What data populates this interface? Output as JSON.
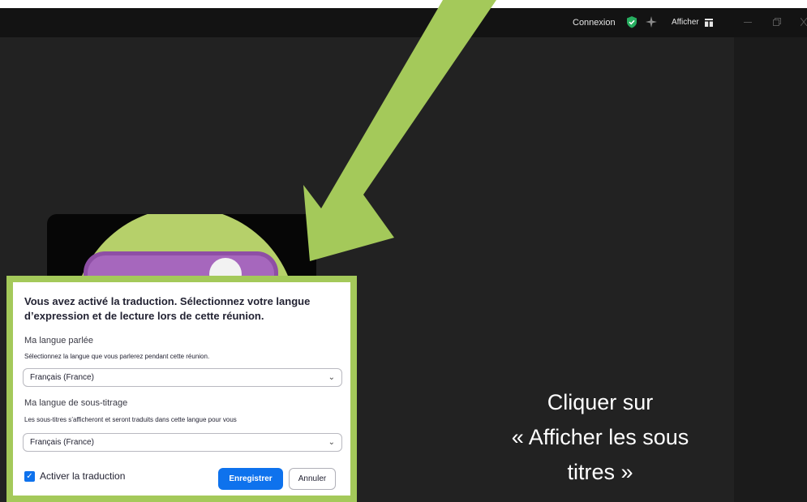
{
  "topbar": {
    "connexion_label": "Connexion",
    "afficher_label": "Afficher",
    "icons": [
      "shield-check-icon",
      "sparkle-icon",
      "grid-icon",
      "minimize-icon",
      "restore-icon",
      "close-icon"
    ]
  },
  "dialog": {
    "title": "Vous avez activé la traduction. Sélectionnez votre langue d’expression et de lecture lors de cette réunion.",
    "spoken": {
      "label": "Ma langue parlée",
      "hint": "Sélectionnez la langue que vous parlerez pendant cette réunion.",
      "value": "Français (France)"
    },
    "subtitle": {
      "label": "Ma langue de sous-titrage",
      "hint": "Les sous-titres s’afficheront et seront traduits dans cette langue pour vous",
      "value": "Français (France)"
    },
    "enable_translation_label": "Activer la traduction",
    "enable_translation_checked": true,
    "save_label": "Enregistrer",
    "cancel_label": "Annuler"
  },
  "annotation": {
    "line1": "Cliquer sur",
    "line2": "« Afficher les sous",
    "line3": "titres »"
  },
  "colors": {
    "accent": "#0e72ed",
    "arrow": "#a4c95a",
    "security": "#27ae60"
  }
}
